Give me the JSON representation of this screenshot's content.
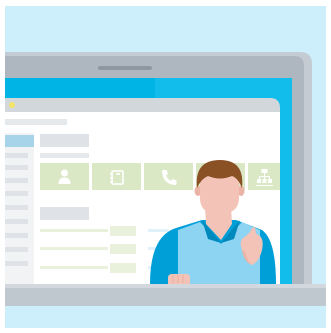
{
  "illustration": {
    "palette": {
      "background": "#cdeffb",
      "laptop_frame": "#aeb6bf",
      "laptop_frame_light": "#c4cbd2",
      "screen_outer": "#00b4e6",
      "screen_glare": "#1fc3ef",
      "window_titlebar": "#d2d7dc",
      "window_body": "#ffffff",
      "sidebar": "#f1f3f5",
      "sidebar_accent": "#a8d4ea",
      "placeholder_bar": "#dfe2e6",
      "tile_fill": "#dbe8c6",
      "tile_icon": "#ffffff",
      "list_line": "#e9f1dd",
      "person_skin": "#f4c3b7",
      "person_hair": "#8a5125",
      "person_shirt": "#009fd8",
      "person_vest": "#8dd3f2",
      "base": "#bfc7cf"
    },
    "icons": [
      "user-icon",
      "address-book-icon",
      "phone-icon",
      "chat-icon",
      "org-chart-icon"
    ]
  }
}
